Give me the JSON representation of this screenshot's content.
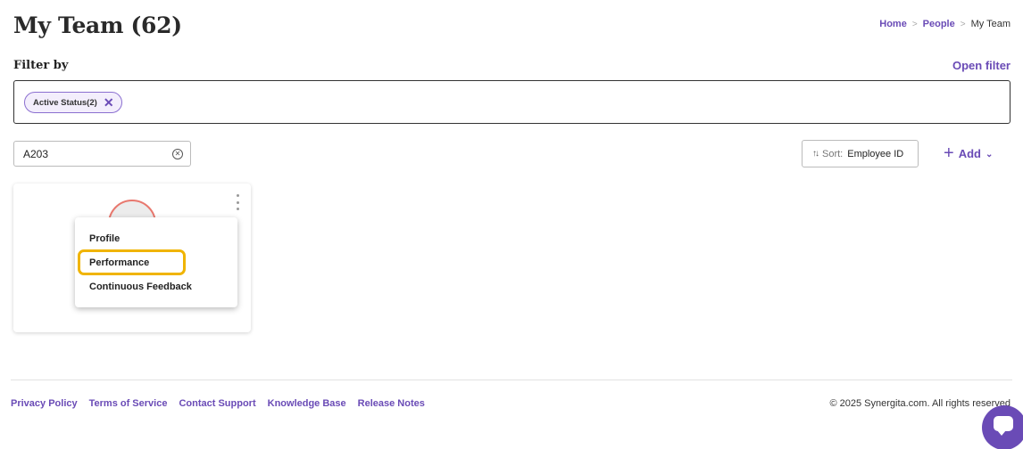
{
  "header": {
    "title": "My Team (62)",
    "breadcrumb": [
      "Home",
      "People",
      "My Team"
    ]
  },
  "filter": {
    "label": "Filter by",
    "open_filter_label": "Open filter",
    "chips": [
      {
        "label": "Active Status(2)"
      }
    ]
  },
  "search": {
    "value": "A203"
  },
  "sort": {
    "prefix": "Sort:",
    "value": "Employee ID"
  },
  "add_button": {
    "label": "Add"
  },
  "card_menu": {
    "items": [
      "Profile",
      "Performance",
      "Continuous Feedback"
    ],
    "highlighted_item": "Performance"
  },
  "footer": {
    "links": [
      "Privacy Policy",
      "Terms of Service",
      "Contact Support",
      "Knowledge Base",
      "Release Notes"
    ],
    "copyright": "© 2025 Synergita.com. All rights reserved"
  },
  "icons": {
    "chip_close": "close-icon",
    "search_clear": "clear-circle-icon",
    "sort": "sort-arrows-icon",
    "add": "plus-icon",
    "add_dropdown": "chevron-down-icon",
    "card_more": "kebab-menu-icon",
    "chat": "chat-icon"
  },
  "colors": {
    "accent": "#6a4bb6",
    "highlight": "#f0b400",
    "avatar_ring": "#e8786e"
  }
}
